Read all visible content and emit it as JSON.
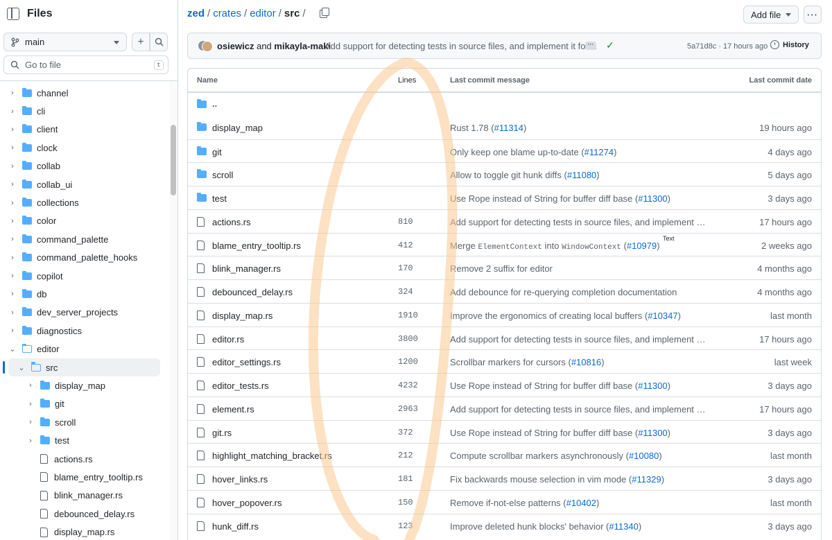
{
  "sidebar": {
    "title": "Files",
    "branch": "main",
    "search_placeholder": "Go to file",
    "search_shortcut": "t",
    "tree": [
      {
        "label": "channel",
        "type": "folder",
        "depth": 0,
        "expanded": false
      },
      {
        "label": "cli",
        "type": "folder",
        "depth": 0,
        "expanded": false
      },
      {
        "label": "client",
        "type": "folder",
        "depth": 0,
        "expanded": false
      },
      {
        "label": "clock",
        "type": "folder",
        "depth": 0,
        "expanded": false
      },
      {
        "label": "collab",
        "type": "folder",
        "depth": 0,
        "expanded": false
      },
      {
        "label": "collab_ui",
        "type": "folder",
        "depth": 0,
        "expanded": false
      },
      {
        "label": "collections",
        "type": "folder",
        "depth": 0,
        "expanded": false
      },
      {
        "label": "color",
        "type": "folder",
        "depth": 0,
        "expanded": false
      },
      {
        "label": "command_palette",
        "type": "folder",
        "depth": 0,
        "expanded": false
      },
      {
        "label": "command_palette_hooks",
        "type": "folder",
        "depth": 0,
        "expanded": false
      },
      {
        "label": "copilot",
        "type": "folder",
        "depth": 0,
        "expanded": false
      },
      {
        "label": "db",
        "type": "folder",
        "depth": 0,
        "expanded": false
      },
      {
        "label": "dev_server_projects",
        "type": "folder",
        "depth": 0,
        "expanded": false
      },
      {
        "label": "diagnostics",
        "type": "folder",
        "depth": 0,
        "expanded": false
      },
      {
        "label": "editor",
        "type": "folder",
        "depth": 0,
        "expanded": true
      },
      {
        "label": "src",
        "type": "folder",
        "depth": 1,
        "expanded": true,
        "selected": true
      },
      {
        "label": "display_map",
        "type": "folder",
        "depth": 2,
        "expanded": false
      },
      {
        "label": "git",
        "type": "folder",
        "depth": 2,
        "expanded": false
      },
      {
        "label": "scroll",
        "type": "folder",
        "depth": 2,
        "expanded": false
      },
      {
        "label": "test",
        "type": "folder",
        "depth": 2,
        "expanded": false
      },
      {
        "label": "actions.rs",
        "type": "file",
        "depth": 2
      },
      {
        "label": "blame_entry_tooltip.rs",
        "type": "file",
        "depth": 2
      },
      {
        "label": "blink_manager.rs",
        "type": "file",
        "depth": 2
      },
      {
        "label": "debounced_delay.rs",
        "type": "file",
        "depth": 2
      },
      {
        "label": "display_map.rs",
        "type": "file",
        "depth": 2
      }
    ]
  },
  "breadcrumb": {
    "root": "zed",
    "parts": [
      "crates",
      "editor"
    ],
    "current": "src",
    "separator": "/"
  },
  "toolbar": {
    "add_file": "Add file",
    "more": "···"
  },
  "commit": {
    "author1": "osiewicz",
    "and": "and",
    "author2": "mikayla-maki",
    "message": "Add support for detecting tests in source files, and implement it for…",
    "sha": "5a71d8c",
    "dot": "·",
    "time": "17 hours ago",
    "history": "History"
  },
  "table": {
    "headers": {
      "name": "Name",
      "lines": "Lines",
      "message": "Last commit message",
      "date": "Last commit date"
    },
    "up": "..",
    "rows": [
      {
        "name": "display_map",
        "type": "folder",
        "lines": "",
        "msg": "Rust 1.78 (",
        "pr": "#11314",
        "msg_end": ")",
        "date": "19 hours ago"
      },
      {
        "name": "git",
        "type": "folder",
        "lines": "",
        "msg": "Only keep one blame up-to-date (",
        "pr": "#11274",
        "msg_end": ")",
        "date": "4 days ago"
      },
      {
        "name": "scroll",
        "type": "folder",
        "lines": "",
        "msg": "Allow to toggle git hunk diffs (",
        "pr": "#11080",
        "msg_end": ")",
        "date": "5 days ago"
      },
      {
        "name": "test",
        "type": "folder",
        "lines": "",
        "msg": "Use Rope instead of String for buffer diff base (",
        "pr": "#11300",
        "msg_end": ")",
        "date": "3 days ago"
      },
      {
        "name": "actions.rs",
        "type": "file",
        "lines": "810",
        "msg": "Add support for detecting tests in source files, and implement it for…",
        "pr": "",
        "msg_end": "",
        "date": "17 hours ago"
      },
      {
        "name": "blame_entry_tooltip.rs",
        "type": "file",
        "lines": "412",
        "msg": "Merge ",
        "code1": "ElementContext",
        "mid": " into ",
        "code2": "WindowContext",
        "msg2": " (",
        "pr": "#10979",
        "msg_end": ")",
        "date": "2 weeks ago"
      },
      {
        "name": "blink_manager.rs",
        "type": "file",
        "lines": "170",
        "msg": "Remove 2 suffix for editor",
        "pr": "",
        "msg_end": "",
        "date": "4 months ago"
      },
      {
        "name": "debounced_delay.rs",
        "type": "file",
        "lines": "324",
        "msg": "Add debounce for re-querying completion documentation",
        "pr": "",
        "msg_end": "",
        "date": "4 months ago"
      },
      {
        "name": "display_map.rs",
        "type": "file",
        "lines": "1910",
        "msg": "Improve the ergonomics of creating local buffers (",
        "pr": "#10347",
        "msg_end": ")",
        "date": "last month"
      },
      {
        "name": "editor.rs",
        "type": "file",
        "lines": "3800",
        "msg": "Add support for detecting tests in source files, and implement it for…",
        "pr": "",
        "msg_end": "",
        "date": "17 hours ago"
      },
      {
        "name": "editor_settings.rs",
        "type": "file",
        "lines": "1200",
        "msg": "Scrollbar markers for cursors (",
        "pr": "#10816",
        "msg_end": ")",
        "date": "last week"
      },
      {
        "name": "editor_tests.rs",
        "type": "file",
        "lines": "4232",
        "msg": "Use Rope instead of String for buffer diff base (",
        "pr": "#11300",
        "msg_end": ")",
        "date": "3 days ago"
      },
      {
        "name": "element.rs",
        "type": "file",
        "lines": "2963",
        "msg": "Add support for detecting tests in source files, and implement it for…",
        "pr": "",
        "msg_end": "",
        "date": "17 hours ago"
      },
      {
        "name": "git.rs",
        "type": "file",
        "lines": "372",
        "msg": "Use Rope instead of String for buffer diff base (",
        "pr": "#11300",
        "msg_end": ")",
        "date": "3 days ago"
      },
      {
        "name": "highlight_matching_bracket.rs",
        "type": "file",
        "lines": "212",
        "msg": "Compute scrollbar markers asynchronously (",
        "pr": "#10080",
        "msg_end": ")",
        "date": "last month"
      },
      {
        "name": "hover_links.rs",
        "type": "file",
        "lines": "181",
        "msg": "Fix backwards mouse selection in vim mode (",
        "pr": "#11329",
        "msg_end": ")",
        "date": "3 days ago"
      },
      {
        "name": "hover_popover.rs",
        "type": "file",
        "lines": "150",
        "msg": "Remove if-not-else patterns (",
        "pr": "#10402",
        "msg_end": ")",
        "date": "last month"
      },
      {
        "name": "hunk_diff.rs",
        "type": "file",
        "lines": "123",
        "msg": "Improve deleted hunk blocks' behavior (",
        "pr": "#11340",
        "msg_end": ")",
        "date": "3 days ago"
      }
    ]
  },
  "tooltip": "Text"
}
